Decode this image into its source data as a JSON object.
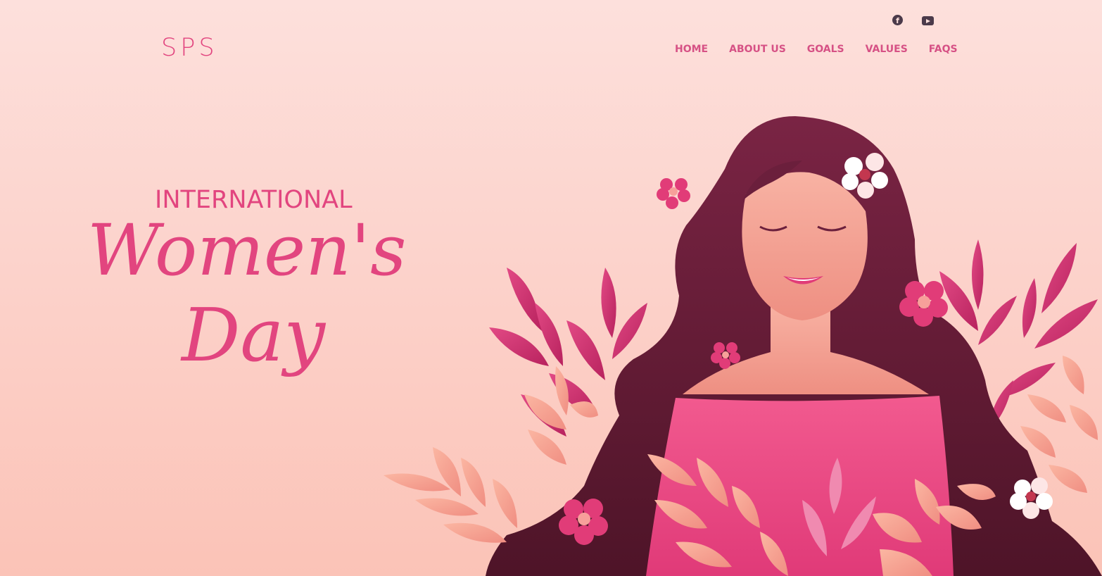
{
  "header": {
    "logo": "SPS",
    "nav": [
      "HOME",
      "ABOUT US",
      "GOALS",
      "VALUES",
      "FAQS"
    ],
    "social": [
      "facebook-icon",
      "youtube-icon"
    ]
  },
  "hero": {
    "line1": "INTERNATIONAL",
    "line2": "Women's",
    "line3": "Day"
  },
  "colors": {
    "accent": "#e2457f",
    "hair": "#6b1f3c",
    "dress": "#f04e86",
    "skin": "#f5a79a",
    "leaf_pink": "#d83a78",
    "leaf_peach": "#f7a493"
  }
}
